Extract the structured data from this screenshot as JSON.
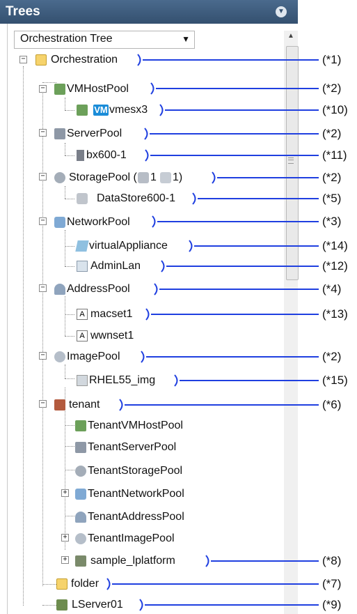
{
  "panel": {
    "title": "Trees",
    "dropdown_value": "Orchestration Tree"
  },
  "tree": {
    "root": "Orchestration",
    "vmhostpool": "VMHostPool",
    "vmesx3_badge": "VM",
    "vmesx3": "vmesx3",
    "serverpool": "ServerPool",
    "bx600": "bx600-1",
    "storagepool": "StoragePool (",
    "storage_count1": "1",
    "storage_count2": "1)",
    "datastore": "DataStore600-1",
    "networkpool": "NetworkPool",
    "virtualappliance": "virtualAppliance",
    "adminlan": "AdminLan",
    "addresspool": "AddressPool",
    "macset": "macset1",
    "wwnset": "wwnset1",
    "imagepool": "ImagePool",
    "rhel": "RHEL55_img",
    "tenant": "tenant",
    "tenant_vmhostpool": "TenantVMHostPool",
    "tenant_serverpool": "TenantServerPool",
    "tenant_storagepool": "TenantStoragePool",
    "tenant_networkpool": "TenantNetworkPool",
    "tenant_addresspool": "TenantAddressPool",
    "tenant_imagepool": "TenantImagePool",
    "sample_platform": "sample_lplatform",
    "folder": "folder",
    "lserver": "LServer01"
  },
  "annotations": {
    "a1": "(*1)",
    "a2": "(*2)",
    "a10": "(*10)",
    "a3": "(*2)",
    "a11": "(*11)",
    "a4": "(*2)",
    "a5": "(*5)",
    "a6": "(*3)",
    "a14": "(*14)",
    "a12": "(*12)",
    "a7": "(*4)",
    "a13": "(*13)",
    "a8": "(*2)",
    "a15": "(*15)",
    "a9": "(*6)",
    "a16": "(*8)",
    "a17": "(*7)",
    "a18": "(*9)"
  },
  "colors": {
    "header": "#3d5b7c",
    "callout": "#1f3fe0",
    "vm_badge": "#1a8cd8",
    "folder": "#f6d36c"
  }
}
